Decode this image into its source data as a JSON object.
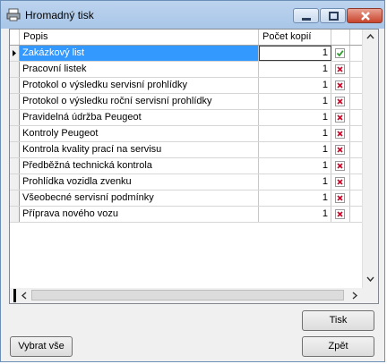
{
  "window": {
    "title": "Hromadný tisk"
  },
  "grid": {
    "columns": [
      "Popis",
      "Počet kopií"
    ],
    "rows": [
      {
        "name": "Zakázkový list",
        "count": "1",
        "checked": true,
        "selected": true
      },
      {
        "name": "Pracovní listek",
        "count": "1",
        "checked": false
      },
      {
        "name": "Protokol o výsledku servisní prohlídky",
        "count": "1",
        "checked": false
      },
      {
        "name": "Protokol o výsledku roční servisní prohlídky",
        "count": "1",
        "checked": false
      },
      {
        "name": "Pravidelná údržba Peugeot",
        "count": "1",
        "checked": false
      },
      {
        "name": "Kontroly Peugeot",
        "count": "1",
        "checked": false
      },
      {
        "name": "Kontrola kvality prací na servisu",
        "count": "1",
        "checked": false
      },
      {
        "name": "Předběžná technická kontrola",
        "count": "1",
        "checked": false
      },
      {
        "name": "Prohlídka vozidla zvenku",
        "count": "1",
        "checked": false
      },
      {
        "name": "Všeobecné servisní podmínky",
        "count": "1",
        "checked": false
      },
      {
        "name": "Příprava nového vozu",
        "count": "1",
        "checked": false
      }
    ]
  },
  "buttons": {
    "print": "Tisk",
    "back": "Zpět",
    "select_all": "Vybrat vše"
  },
  "colors": {
    "selection": "#3399ff",
    "check_green": "#2a9d2a",
    "cross_red": "#c8102e"
  },
  "icons": {
    "check": "check-icon",
    "cross": "cross-icon"
  }
}
